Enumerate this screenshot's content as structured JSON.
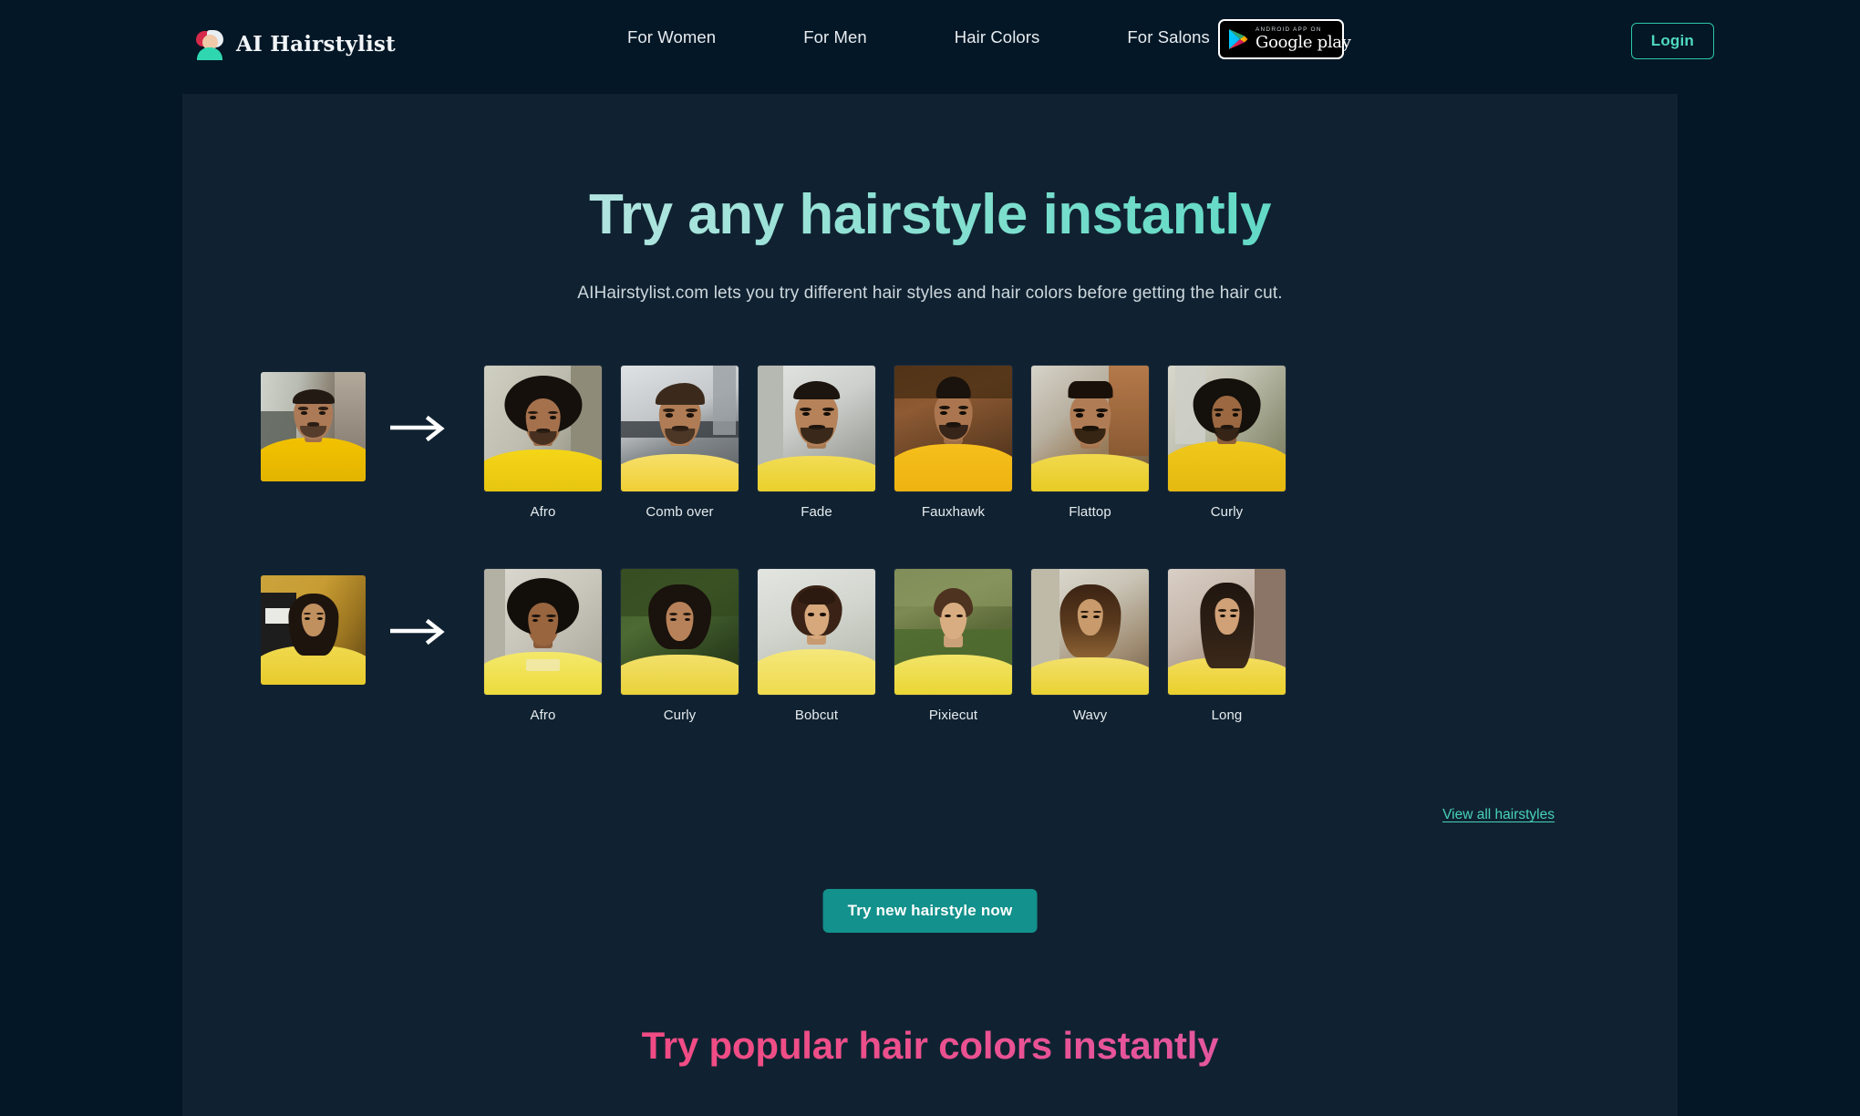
{
  "header": {
    "brand": {
      "name": "AI Hairstylist",
      "icon": "avatar-icon"
    },
    "nav": [
      {
        "label": "For Women"
      },
      {
        "label": "For Men"
      },
      {
        "label": "Hair Colors"
      },
      {
        "label": "For Salons"
      }
    ],
    "google_play": {
      "small": "ANDROID APP ON",
      "big": "Google play",
      "icon": "google-play-triangle-icon"
    },
    "login_label": "Login"
  },
  "hero": {
    "title": "Try any hairstyle instantly",
    "subtitle": "AIHairstylist.com lets you try different hair styles and hair colors before getting the hair cut."
  },
  "rows": [
    {
      "id": "men",
      "source_alt": "man-in-yellow-tshirt-photo",
      "arrow": "arrow-right-icon",
      "cards": [
        {
          "label": "Afro"
        },
        {
          "label": "Comb over"
        },
        {
          "label": "Fade"
        },
        {
          "label": "Fauxhawk"
        },
        {
          "label": "Flattop"
        },
        {
          "label": "Curly"
        }
      ]
    },
    {
      "id": "women",
      "source_alt": "woman-in-yellow-tshirt-photo",
      "arrow": "arrow-right-icon",
      "cards": [
        {
          "label": "Afro"
        },
        {
          "label": "Curly"
        },
        {
          "label": "Bobcut"
        },
        {
          "label": "Pixiecut"
        },
        {
          "label": "Wavy"
        },
        {
          "label": "Long"
        }
      ]
    }
  ],
  "view_all_label": "View all hairstyles",
  "cta_label": "Try new hairstyle now",
  "colors_section": {
    "title": "Try popular hair colors instantly"
  },
  "colors": {
    "page_bg": "#041726",
    "panel_bg": "#102231",
    "accent_teal": "#2ec7ab",
    "cta_bg": "#13918c",
    "pink": "#f5437f",
    "text": "#e5ebef"
  }
}
